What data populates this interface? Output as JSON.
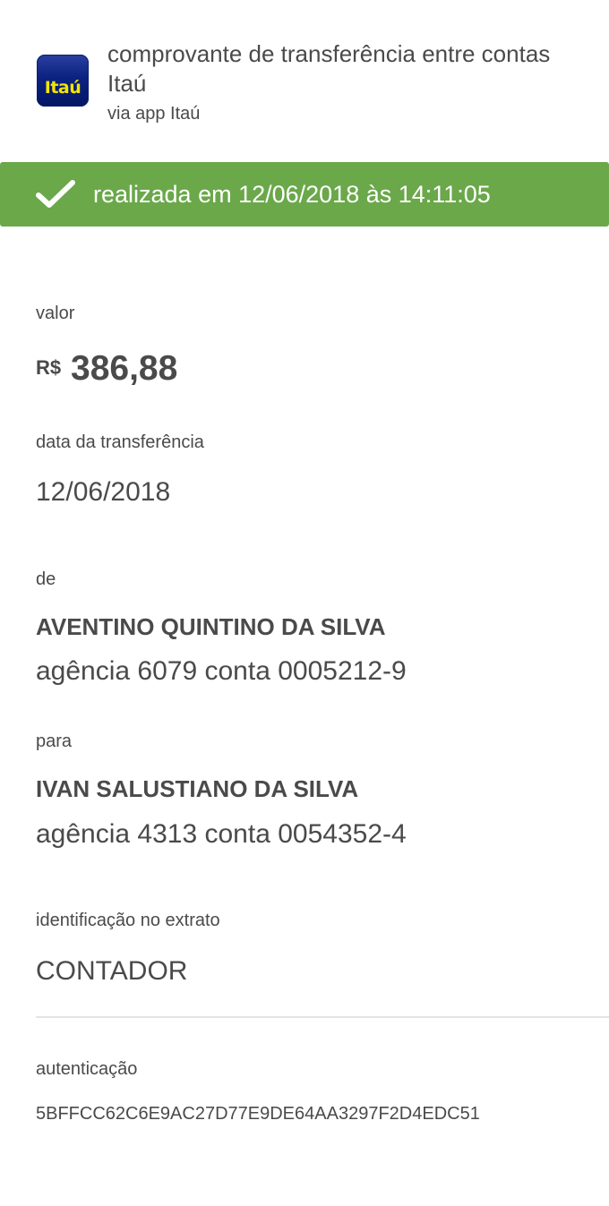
{
  "header": {
    "logo_text": "Itaú",
    "title": "comprovante de transferência entre contas Itaú",
    "subtitle": "via app Itaú"
  },
  "status": {
    "icon": "check-icon",
    "text": "realizada em 12/06/2018 às 14:11:05",
    "color": "#6aa84a"
  },
  "valor": {
    "label": "valor",
    "currency": "R$",
    "amount": "386,88"
  },
  "data_transferencia": {
    "label": "data da transferência",
    "value": "12/06/2018"
  },
  "de": {
    "label": "de",
    "name": "AVENTINO QUINTINO DA SILVA",
    "account": "agência 6079 conta 0005212-9"
  },
  "para": {
    "label": "para",
    "name": "IVAN SALUSTIANO DA SILVA",
    "account": "agência 4313 conta 0054352-4"
  },
  "identificacao": {
    "label": "identificação no extrato",
    "value": "CONTADOR"
  },
  "autenticacao": {
    "label": "autenticação",
    "value": "5BFFCC62C6E9AC27D77E9DE64AA3297F2D4EDC51"
  }
}
